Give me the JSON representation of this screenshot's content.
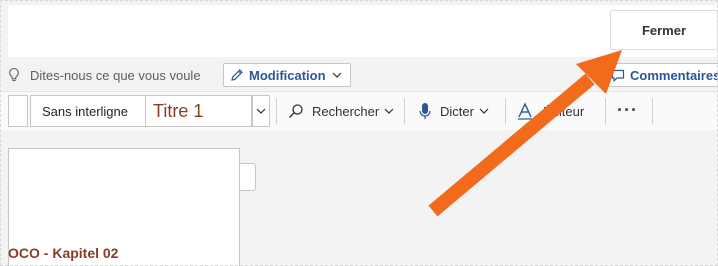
{
  "topbar": {
    "close_label": "Fermer"
  },
  "ribbon": {
    "tell_me_placeholder": "Dites-nous ce que vous voule",
    "editing_mode_label": "Modification",
    "comments_label": "Commentaires"
  },
  "toolbar": {
    "style_normal": "Sans interligne",
    "style_heading": "Titre 1",
    "find_label": "Rechercher",
    "dictate_label": "Dicter",
    "editor_label": "Éditeur",
    "more_label": "···"
  },
  "document": {
    "heading_text": "OCO - Kapitel 02"
  },
  "colors": {
    "accent": "#2b579a",
    "heading": "#8a3b29",
    "annotation_arrow": "#f26b1d"
  },
  "icons": [
    "lightbulb-icon",
    "pencil-icon",
    "chevron-down-icon",
    "comment-icon",
    "search-icon",
    "microphone-icon",
    "editor-icon",
    "more-icon"
  ]
}
